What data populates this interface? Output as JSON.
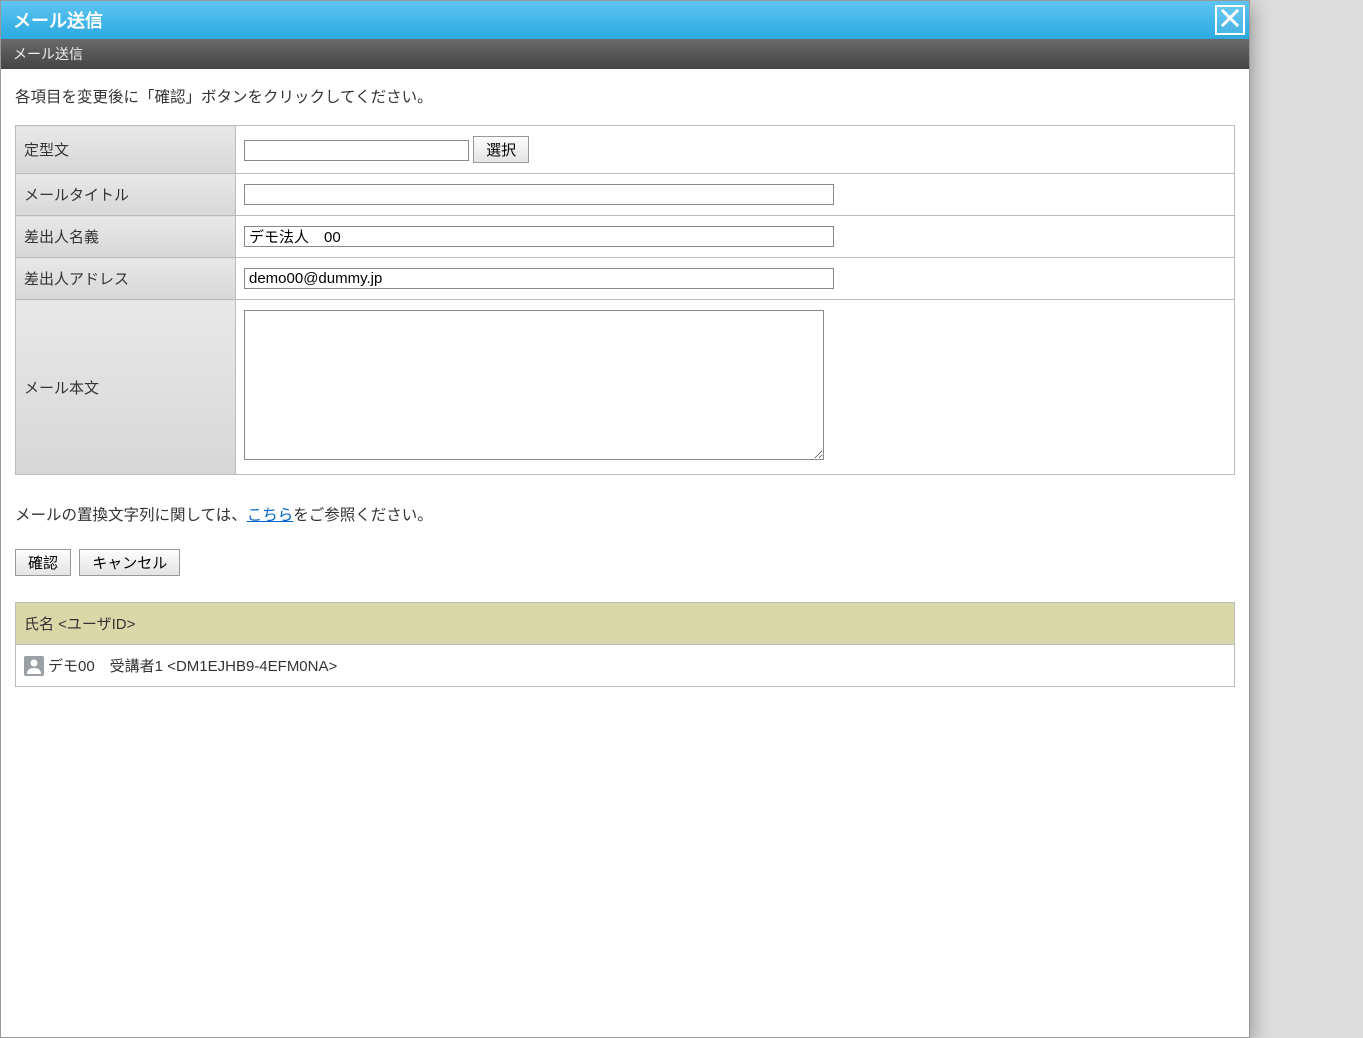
{
  "dialog": {
    "title": "メール送信",
    "subtitle": "メール送信"
  },
  "instruction": "各項目を変更後に「確認」ボタンをクリックしてください。",
  "form": {
    "template_label": "定型文",
    "template_value": "",
    "template_select_button": "選択",
    "title_label": "メールタイトル",
    "title_value": "",
    "sender_name_label": "差出人名義",
    "sender_name_value": "デモ法人　00",
    "sender_address_label": "差出人アドレス",
    "sender_address_value": "demo00@dummy.jp",
    "body_label": "メール本文",
    "body_value": ""
  },
  "help": {
    "prefix": "メールの置換文字列に関しては、",
    "link": "こちら",
    "suffix": "をご参照ください。"
  },
  "buttons": {
    "confirm": "確認",
    "cancel": "キャンセル"
  },
  "recipients": {
    "header": "氏名 <ユーザID>",
    "rows": [
      {
        "text": "デモ00　受講者1 <DM1EJHB9-4EFM0NA>"
      }
    ]
  }
}
